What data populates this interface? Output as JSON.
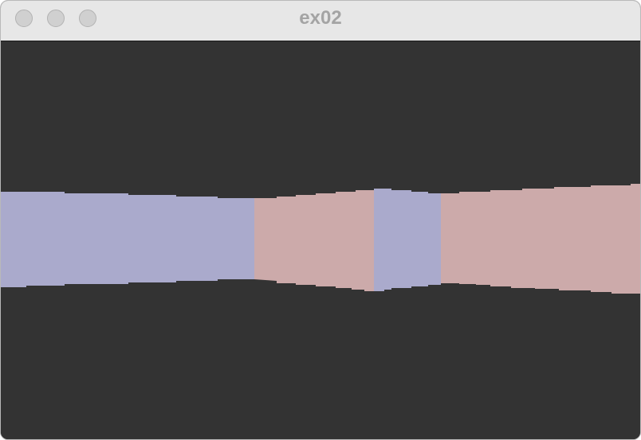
{
  "window": {
    "title": "ex02"
  },
  "titlebar": {
    "buttons": [
      {
        "name": "close",
        "color": "#d0d0d0"
      },
      {
        "name": "minimize",
        "color": "#d0d0d0"
      },
      {
        "name": "zoom",
        "color": "#d0d0d0"
      }
    ]
  },
  "scene": {
    "background_color": "#333333",
    "wall_colors": {
      "blue": "#aaaacc",
      "red": "#ccaaaa"
    },
    "walls": [
      {
        "name": "wall-1",
        "color_key": "blue"
      },
      {
        "name": "wall-2",
        "color_key": "red"
      },
      {
        "name": "wall-3",
        "color_key": "blue"
      },
      {
        "name": "wall-4",
        "color_key": "red"
      }
    ]
  }
}
